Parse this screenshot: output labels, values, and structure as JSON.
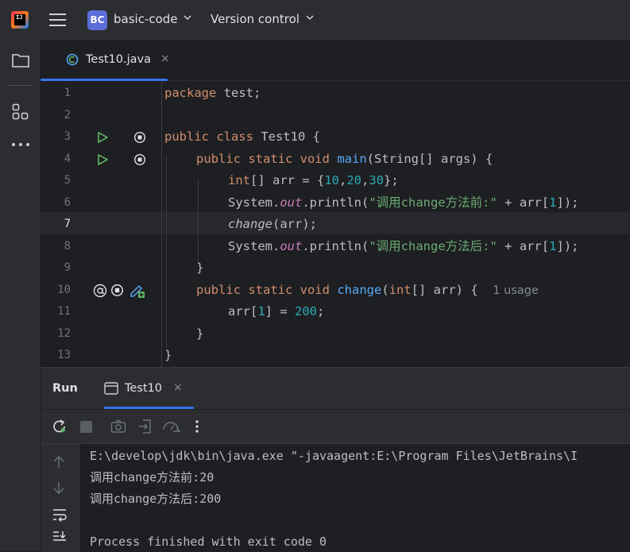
{
  "header": {
    "project_badge": "BC",
    "project_name": "basic-code",
    "vcs_label": "Version control"
  },
  "editor_tab": {
    "label": "Test10.java",
    "close": "×"
  },
  "editor": {
    "current_line": 7,
    "lines": [
      {
        "n": "1"
      },
      {
        "n": "2"
      },
      {
        "n": "3"
      },
      {
        "n": "4"
      },
      {
        "n": "5"
      },
      {
        "n": "6"
      },
      {
        "n": "7"
      },
      {
        "n": "8"
      },
      {
        "n": "9"
      },
      {
        "n": "10"
      },
      {
        "n": "11"
      },
      {
        "n": "12"
      },
      {
        "n": "13"
      }
    ],
    "code": {
      "l1_kw": "package",
      "l1_rest": " test;",
      "l3_kw": "public class",
      "l3_rest": " Test10 {",
      "l4_kw": "public static void",
      "l4_fn": "main",
      "l4_rest": "(String[] args) {",
      "l5_kw": "int",
      "l5_a": "[] arr = {",
      "l5_n1": "10",
      "l5_c1": ",",
      "l5_n2": "20",
      "l5_c2": ",",
      "l5_n3": "30",
      "l5_end": "};",
      "l6_a": "System.",
      "l6_out": "out",
      "l6_b": ".println(",
      "l6_str": "\"调用change方法前:\"",
      "l6_c": " + arr[",
      "l6_n": "1",
      "l6_d": "]);",
      "l7_fn": "change",
      "l7_rest": "(arr);",
      "l8_a": "System.",
      "l8_out": "out",
      "l8_b": ".println(",
      "l8_str": "\"调用change方法后:\"",
      "l8_c": " + arr[",
      "l8_n": "1",
      "l8_d": "]);",
      "l9": "}",
      "l10_kw": "public static void",
      "l10_fn": "change",
      "l10_a": "(",
      "l10_kw2": "int",
      "l10_b": "[] arr) {",
      "l10_hint": "1 usage",
      "l11_a": "arr[",
      "l11_n": "1",
      "l11_b": "] = ",
      "l11_n2": "200",
      "l11_c": ";",
      "l12": "}",
      "l13": "}"
    }
  },
  "run_panel": {
    "title": "Run",
    "tab_label": "Test10",
    "tab_close": "×",
    "console": [
      "E:\\develop\\jdk\\bin\\java.exe \"-javaagent:E:\\Program Files\\JetBrains\\I",
      "调用change方法前:20",
      "调用change方法后:200",
      "",
      "Process finished with exit code 0"
    ]
  },
  "colors": {
    "accent": "#3574f0",
    "keyword": "#cf8e6d",
    "number": "#2aacb8",
    "string": "#6aab73",
    "function": "#56a8f5",
    "run_green": "#5fb865"
  }
}
